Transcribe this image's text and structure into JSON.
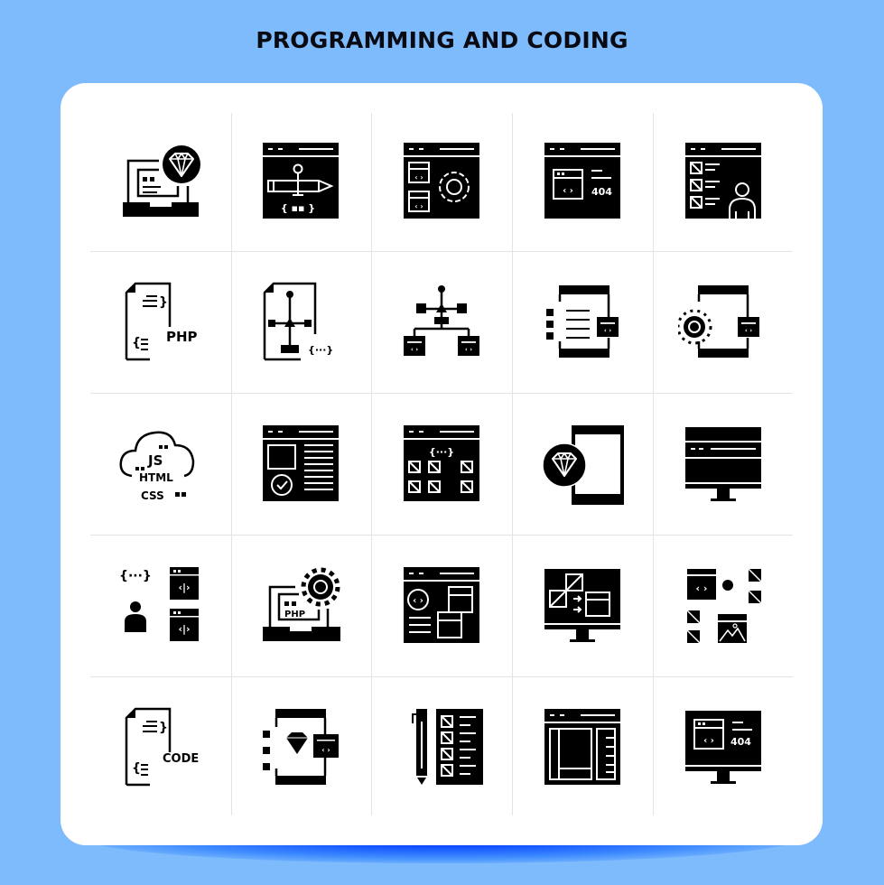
{
  "title": "PROGRAMMING AND CODING",
  "colors": {
    "background": "#7dbbfd",
    "card": "#ffffff",
    "icon": "#000000",
    "grid_line": "#e3e3e3",
    "glow": "#0a0adc"
  },
  "grid": {
    "rows": 5,
    "columns": 5,
    "icons": [
      {
        "name": "laptop-diamond-icon",
        "text": ""
      },
      {
        "name": "browser-pen-tool-icon",
        "text": "{ ▪▪ }"
      },
      {
        "name": "browser-code-settings-icon",
        "text": ""
      },
      {
        "name": "browser-error-404-icon",
        "text": "404"
      },
      {
        "name": "browser-user-list-icon",
        "text": ""
      },
      {
        "name": "php-file-icon",
        "text": "PHP"
      },
      {
        "name": "file-vector-code-icon",
        "text": "{···}"
      },
      {
        "name": "vector-hierarchy-code-icon",
        "text": ""
      },
      {
        "name": "mobile-list-code-icon",
        "text": ""
      },
      {
        "name": "mobile-settings-code-icon",
        "text": ""
      },
      {
        "name": "cloud-js-html-css-icon",
        "labels": [
          "JS",
          "HTML",
          "CSS"
        ]
      },
      {
        "name": "browser-layout-check-icon",
        "text": ""
      },
      {
        "name": "browser-grid-code-icon",
        "text": "{···}"
      },
      {
        "name": "mobile-diamond-icon",
        "text": ""
      },
      {
        "name": "monitor-browser-icon",
        "text": ""
      },
      {
        "name": "developer-code-windows-icon",
        "text": "{···}"
      },
      {
        "name": "laptop-php-settings-icon",
        "text": "PHP"
      },
      {
        "name": "browser-code-windows-icon",
        "text": ""
      },
      {
        "name": "monitor-design-transfer-icon",
        "text": ""
      },
      {
        "name": "code-image-elements-icon",
        "text": ""
      },
      {
        "name": "code-file-icon",
        "text": "CODE"
      },
      {
        "name": "mobile-diamond-code-icon",
        "text": ""
      },
      {
        "name": "pen-checklist-icon",
        "text": ""
      },
      {
        "name": "browser-layout-icon",
        "text": ""
      },
      {
        "name": "monitor-error-404-icon",
        "text": "404"
      }
    ]
  }
}
